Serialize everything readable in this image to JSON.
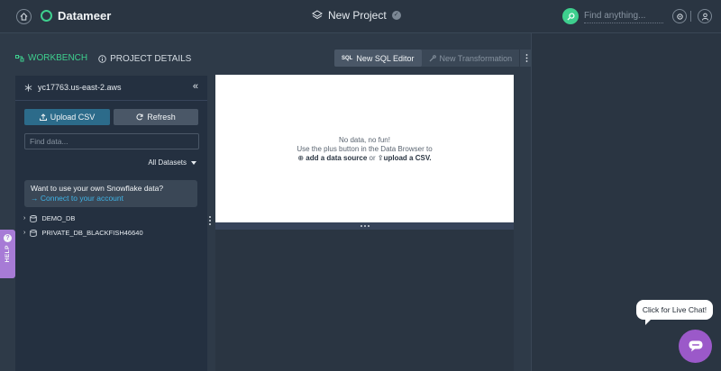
{
  "brand": {
    "name": "Datameer",
    "accent": "#3ecf8e"
  },
  "project": {
    "title": "New Project"
  },
  "search": {
    "placeholder": "Find anything..."
  },
  "tabs": [
    {
      "label": "WORKBENCH",
      "active": true,
      "icon": "workbench-icon"
    },
    {
      "label": "PROJECT DETAILS",
      "active": false,
      "icon": "info-icon"
    }
  ],
  "editor_toolbar": {
    "sql_badge": "SQL",
    "new_sql_editor": "New SQL Editor",
    "new_transformation": "New Transformation"
  },
  "sidebar": {
    "connection": "yc17763.us-east-2.aws",
    "upload_label": "Upload CSV",
    "refresh_label": "Refresh",
    "find_placeholder": "Find data...",
    "dataset_filter": "All Datasets",
    "promo": {
      "title": "Want to use your own Snowflake data?",
      "link": "→ Connect to your account"
    },
    "databases": [
      {
        "name": "DEMO_DB"
      },
      {
        "name": "PRIVATE_DB_BLACKFISH46640"
      }
    ]
  },
  "canvas": {
    "line1": "No data, no fun!",
    "line2": "Use the plus button in the Data Browser to",
    "add_source": "add a data source",
    "or": "or",
    "upload": "upload a CSV."
  },
  "help": {
    "label": "HELP"
  },
  "chat": {
    "bubble": "Click for Live Chat!"
  }
}
